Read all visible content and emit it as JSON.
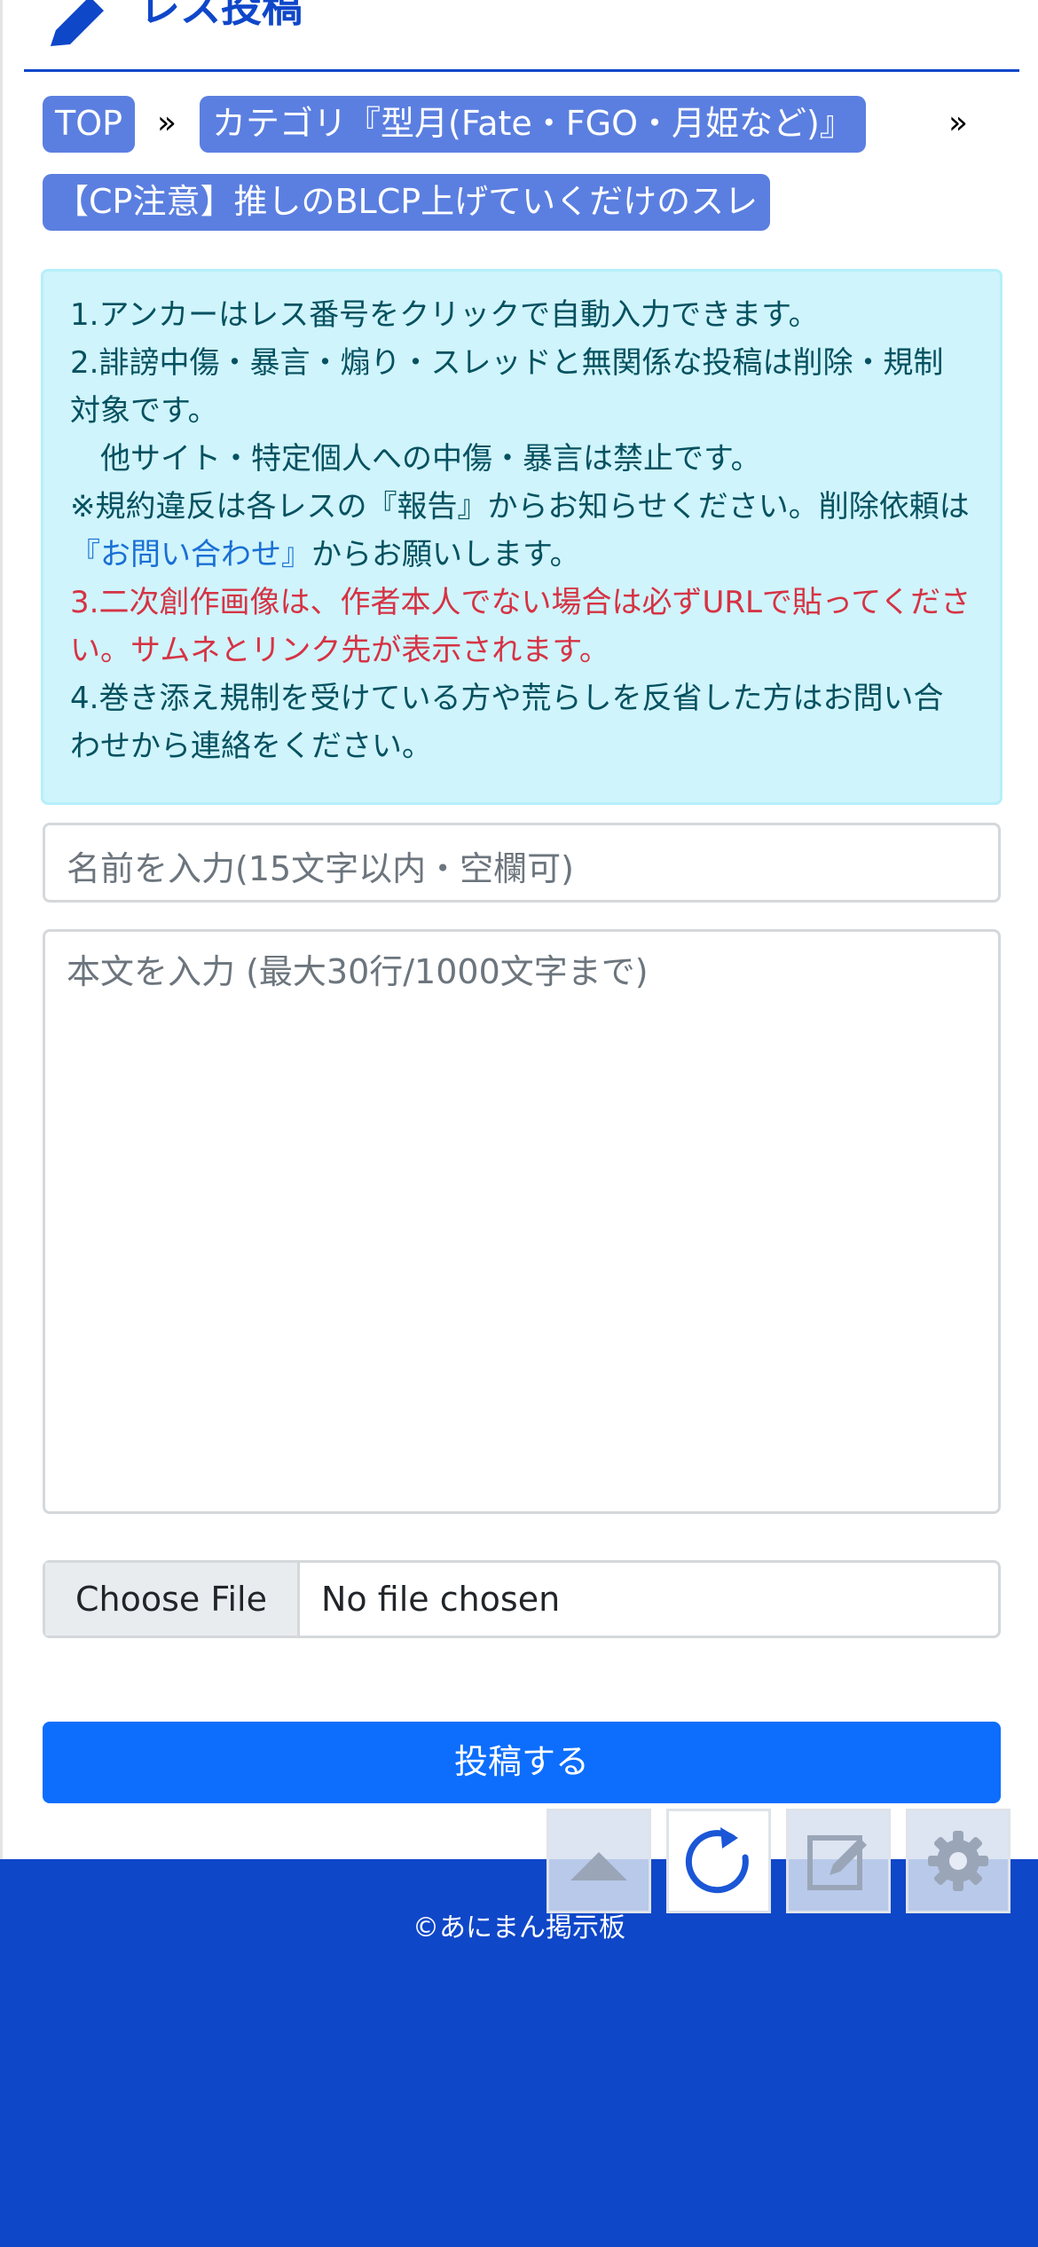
{
  "header": {
    "title": "レス投稿"
  },
  "breadcrumb": {
    "top_label": "TOP",
    "separator": "»",
    "category_label": "カテゴリ『型月(Fate・FGO・月姫など)』",
    "thread_label": "【CP注意】推しのBLCP上げていくだけのスレ"
  },
  "notice": {
    "line1": "1.アンカーはレス番号をクリックで自動入力できます。",
    "line2": "2.誹謗中傷・暴言・煽り・スレッドと無関係な投稿は削除・規制対象です。",
    "line3": "　他サイト・特定個人への中傷・暴言は禁止です。",
    "line4_pre": "※規約違反は各レスの『報告』からお知らせください。削除依頼は",
    "line4_link": "『お問い合わせ』",
    "line4_post": "からお願いします。",
    "line5": "3.二次創作画像は、作者本人でない場合は必ずURLで貼ってください。サムネとリンク先が表示されます。",
    "line6": "4.巻き添え規制を受けている方や荒らしを反省した方はお問い合わせから連絡をください。"
  },
  "form": {
    "name_placeholder": "名前を入力(15文字以内・空欄可)",
    "body_placeholder": "本文を入力 (最大30行/1000文字まで)",
    "file_button": "Choose File",
    "file_status": "No file chosen",
    "submit_label": "投稿する"
  },
  "footer": {
    "copyright": "©あにまん掲示板"
  },
  "floating_buttons": [
    {
      "name": "scroll-top",
      "icon": "triangle-up-icon"
    },
    {
      "name": "reload",
      "icon": "reload-icon"
    },
    {
      "name": "write",
      "icon": "pencil-square-icon"
    },
    {
      "name": "settings",
      "icon": "gear-icon"
    }
  ],
  "colors": {
    "brand": "#0f47c9",
    "primary": "#0d6efd",
    "notice_bg": "#cff4fc",
    "warning_red": "#d63344"
  }
}
